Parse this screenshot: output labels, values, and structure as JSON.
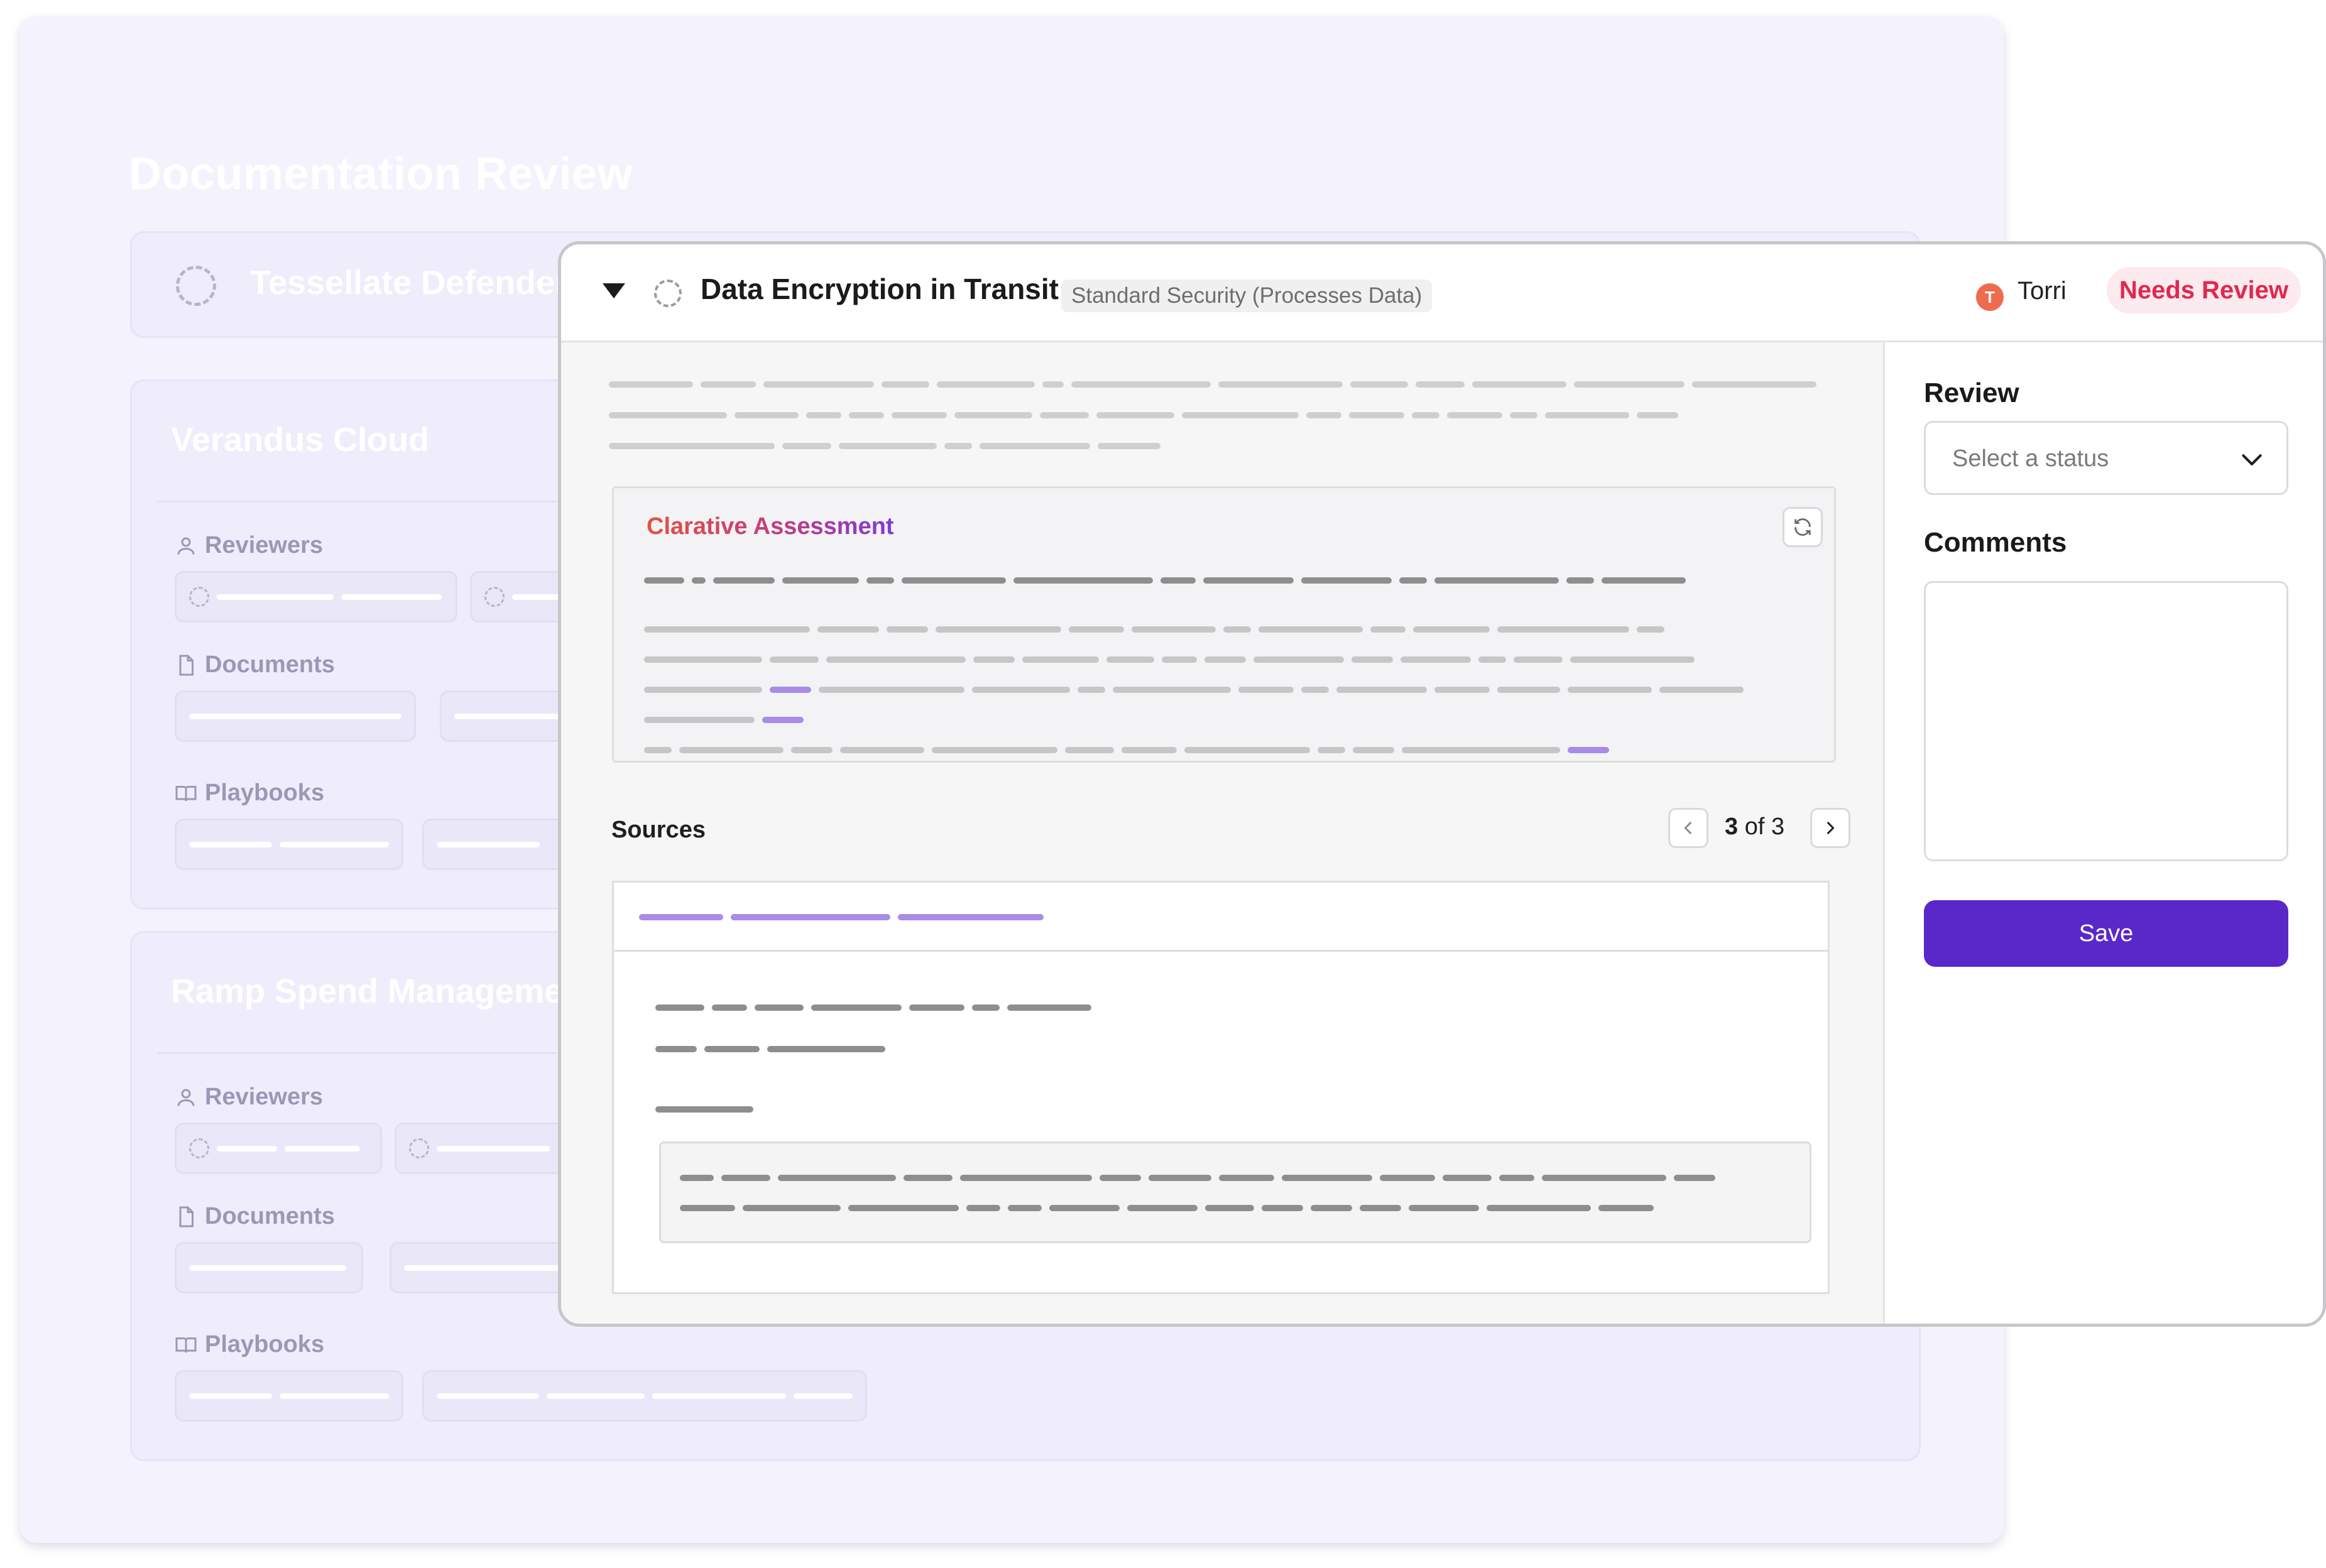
{
  "background": {
    "page_title": "Documentation Review",
    "vendor_row": {
      "name": "Tessellate Defender"
    },
    "cards": [
      {
        "title": "Verandus Cloud",
        "reviewers_label": "Reviewers",
        "documents_label": "Documents",
        "playbooks_label": "Playbooks"
      },
      {
        "title": "Ramp Spend Management",
        "reviewers_label": "Reviewers",
        "documents_label": "Documents",
        "playbooks_label": "Playbooks"
      }
    ]
  },
  "detail": {
    "title": "Data Encryption in Transit",
    "category_badge": "Standard Security (Processes Data)",
    "assignee": {
      "initial": "T",
      "name": "Torri"
    },
    "status_badge": "Needs Review",
    "assessment": {
      "title": "Clarative Assessment"
    },
    "sources": {
      "label": "Sources",
      "current": "3",
      "of_text": " of 3"
    }
  },
  "review_panel": {
    "review_label": "Review",
    "status_placeholder": "Select a status",
    "comments_label": "Comments",
    "save_label": "Save"
  },
  "icons": {
    "collapse": "caret-down-icon",
    "status": "pending-spinner-icon",
    "refresh": "refresh-icon",
    "prev": "chevron-left-icon",
    "next": "chevron-right-icon",
    "select": "chevron-down-icon",
    "reviewers": "user-icon",
    "documents": "document-icon",
    "playbooks": "book-icon"
  },
  "colors": {
    "accent": "#5a27c9",
    "status_badge_text": "#e1284f",
    "status_badge_bg": "#fbeaee",
    "avatar": "#ee6b4d",
    "assessment_gradient_start": "#e2533d",
    "assessment_gradient_end": "#7e3bd8",
    "placeholder_skeleton": "#8e8e8e",
    "highlight_skeleton": "#a98be8"
  }
}
